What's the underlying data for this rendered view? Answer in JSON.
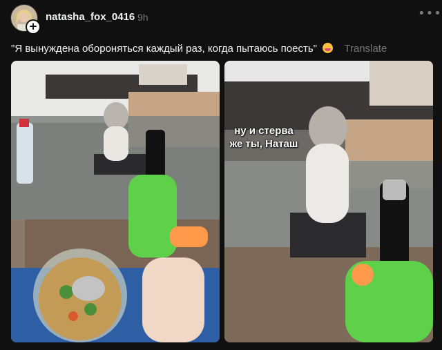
{
  "post": {
    "username": "natasha_fox_0416",
    "time": "9h",
    "more_icon": "more-horizontal-icon",
    "caption": "\"Я вынуждена обороняться каждый раз, когда пытаюсь поесть\"",
    "emoji_icon": "grinning-tongue-emoji",
    "translate_label": "Translate",
    "meme_text_line1": "ну и стерва",
    "meme_text_line2": "же ты, Наташ"
  }
}
